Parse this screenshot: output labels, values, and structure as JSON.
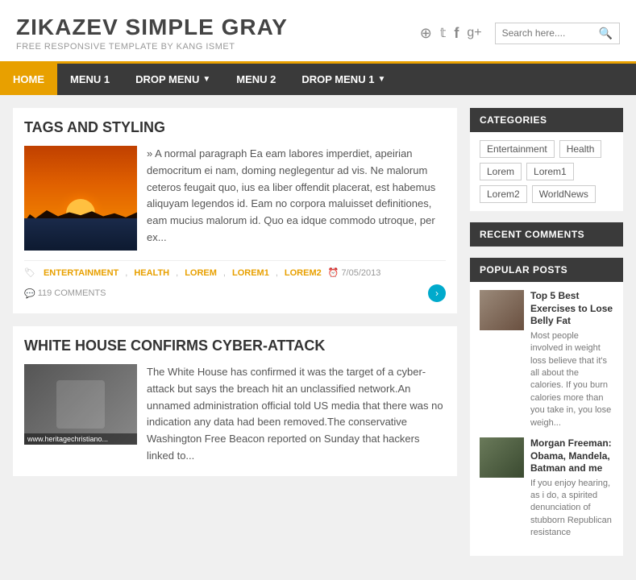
{
  "header": {
    "site_title": "ZIKAZEV SIMPLE GRAY",
    "site_subtitle": "FREE RESPONSIVE TEMPLATE BY KANG ISMET",
    "search_placeholder": "Search here....",
    "social": {
      "pinterest": "𝓟",
      "twitter": "🐦",
      "facebook": "f",
      "googleplus": "g⁺"
    }
  },
  "nav": {
    "items": [
      {
        "label": "HOME",
        "active": true,
        "has_dropdown": false
      },
      {
        "label": "MENU 1",
        "active": false,
        "has_dropdown": false
      },
      {
        "label": "DROP MENU",
        "active": false,
        "has_dropdown": true
      },
      {
        "label": "MENU 2",
        "active": false,
        "has_dropdown": false
      },
      {
        "label": "DROP MENU 1",
        "active": false,
        "has_dropdown": true
      }
    ]
  },
  "articles": [
    {
      "id": "tags-styling",
      "title": "TAGS AND STYLING",
      "text": "» A normal paragraph Ea eam labores imperdiet, apeirian democritum ei nam, doming neglegentur ad vis. Ne malorum ceteros feugait quo, ius ea liber offendit placerat, est habemus aliquyam legendos id. Eam no corpora maluisset definitiones, eam mucius malorum id. Quo ea idque commodo utroque, per ex...",
      "tags": [
        "ENTERTAINMENT",
        "HEALTH",
        "LOREM",
        "LOREM1",
        "LOREM2"
      ],
      "date": "7/05/2013",
      "comments": "119 COMMENTS"
    },
    {
      "id": "cyber-attack",
      "title": "WHITE HOUSE CONFIRMS CYBER-ATTACK",
      "image_overlay": "www.heritagechristiano...",
      "text": "The White House has confirmed it was the target of a cyber-attack but says the breach hit an unclassified network.An unnamed administration official told US media that there was no indication any data had been removed.The conservative Washington Free Beacon reported on Sunday that hackers linked to..."
    }
  ],
  "sidebar": {
    "categories_header": "CATEGORIES",
    "categories": [
      "Entertainment",
      "Health",
      "Lorem",
      "Lorem1",
      "Lorem2",
      "WorldNews"
    ],
    "recent_comments_header": "RECENT COMMENTS",
    "popular_posts_header": "POPULAR POSTS",
    "popular_posts": [
      {
        "title": "Top 5 Best Exercises to Lose Belly Fat",
        "excerpt": "Most people involved in weight loss believe that it's all about the calories. If you burn calories more than you take in, you lose weigh..."
      },
      {
        "title": "Morgan Freeman: Obama, Mandela, Batman and me",
        "excerpt": "If you enjoy hearing, as i do, a spirited denunciation of stubborn Republican resistance"
      }
    ]
  }
}
